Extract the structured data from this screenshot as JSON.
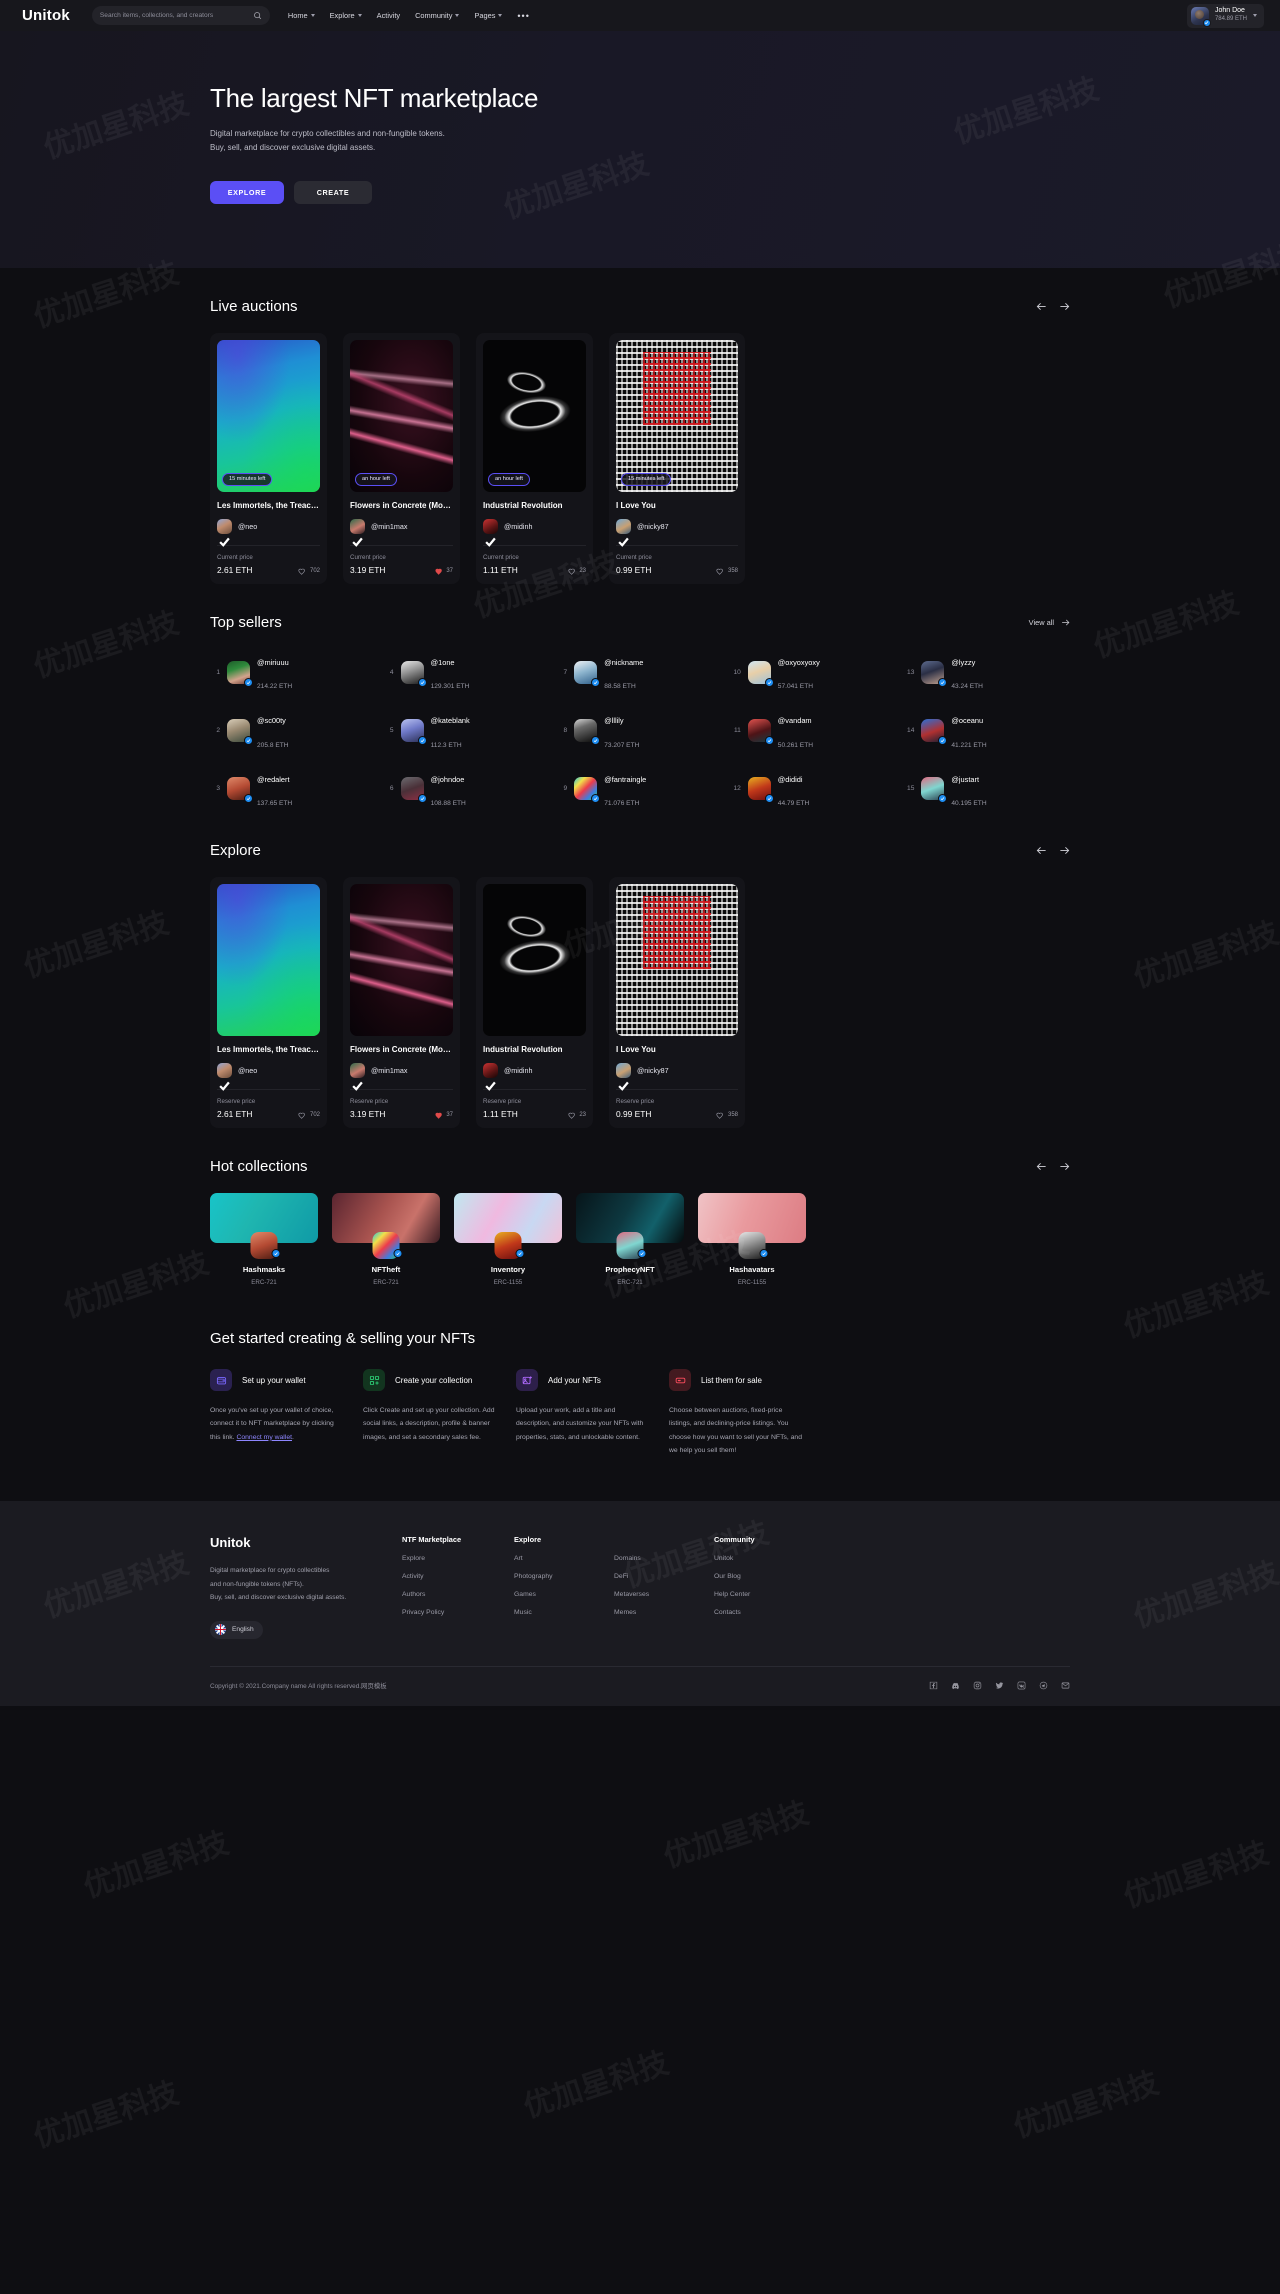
{
  "brand": {
    "name": "Unitok"
  },
  "header": {
    "search": {
      "placeholder": "Search items, collections, and creators",
      "value": "",
      "icon": "search-icon"
    },
    "nav": [
      {
        "label": "Home",
        "caret": true
      },
      {
        "label": "Explore",
        "caret": true
      },
      {
        "label": "Activity",
        "caret": false
      },
      {
        "label": "Community",
        "caret": true
      },
      {
        "label": "Pages",
        "caret": true
      }
    ],
    "more_label": "•••",
    "user": {
      "name": "John Doe",
      "balance": "784.89 ETH",
      "verified": true
    }
  },
  "hero": {
    "title": "The largest NFT marketplace",
    "subtitle_line1": "Digital marketplace for crypto collectibles and non-fungible tokens.",
    "subtitle_line2": "Buy, sell, and discover exclusive digital assets.",
    "primary_button": "EXPLORE",
    "secondary_button": "CREATE",
    "accent_color": "#5b4ff5"
  },
  "live_auctions": {
    "title": "Live auctions",
    "price_label": "Current price",
    "items": [
      {
        "title": "Les Immortels, the Treacher…",
        "badge": "15 minutes left",
        "creator": "@neo",
        "price": "2.61 ETH",
        "likes": "702",
        "liked": false,
        "art": "t-ocean",
        "avatar_class": "av-neo"
      },
      {
        "title": "Flowers in Concrete (Modal)",
        "badge": "an hour left",
        "creator": "@min1max",
        "price": "3.19 ETH",
        "likes": "37",
        "liked": true,
        "art": "t-flowers",
        "avatar_class": "av-min1max"
      },
      {
        "title": "Industrial Revolution",
        "badge": "an hour left",
        "creator": "@midinh",
        "price": "1.11 ETH",
        "likes": "23",
        "liked": false,
        "art": "t-indus",
        "avatar_class": "av-midinh"
      },
      {
        "title": "I Love You",
        "badge": "15 minutes left",
        "creator": "@nicky87",
        "price": "0.99 ETH",
        "likes": "358",
        "liked": false,
        "art": "t-binary",
        "avatar_class": "av-nicky"
      }
    ]
  },
  "top_sellers": {
    "title": "Top sellers",
    "view_all": "View all",
    "items": [
      {
        "rank": "1",
        "name": "@miriuuu",
        "eth": "214.22 ETH",
        "avatar_class": "av-miriuuu"
      },
      {
        "rank": "2",
        "name": "@sc00ty",
        "eth": "205.8 ETH",
        "avatar_class": "av-sc00ty"
      },
      {
        "rank": "3",
        "name": "@redalert",
        "eth": "137.65 ETH",
        "avatar_class": "av-redalert"
      },
      {
        "rank": "4",
        "name": "@1one",
        "eth": "129.301 ETH",
        "avatar_class": "av-1one"
      },
      {
        "rank": "5",
        "name": "@kateblank",
        "eth": "112.3 ETH",
        "avatar_class": "av-kateblank"
      },
      {
        "rank": "6",
        "name": "@johndoe",
        "eth": "108.88 ETH",
        "avatar_class": "av-johndoe"
      },
      {
        "rank": "7",
        "name": "@nickname",
        "eth": "88.58 ETH",
        "avatar_class": "av-nickname"
      },
      {
        "rank": "8",
        "name": "@lllily",
        "eth": "73.207 ETH",
        "avatar_class": "av-lllily"
      },
      {
        "rank": "9",
        "name": "@fantraingle",
        "eth": "71.076 ETH",
        "avatar_class": "av-fantraingle"
      },
      {
        "rank": "10",
        "name": "@oxyoxyoxy",
        "eth": "57.041 ETH",
        "avatar_class": "av-oxy"
      },
      {
        "rank": "11",
        "name": "@vandam",
        "eth": "50.261 ETH",
        "avatar_class": "av-vandam"
      },
      {
        "rank": "12",
        "name": "@dididi",
        "eth": "44.79 ETH",
        "avatar_class": "av-dididi"
      },
      {
        "rank": "13",
        "name": "@lyzzy",
        "eth": "43.24 ETH",
        "avatar_class": "av-lyzzy"
      },
      {
        "rank": "14",
        "name": "@oceanu",
        "eth": "41.221 ETH",
        "avatar_class": "av-oceanu"
      },
      {
        "rank": "15",
        "name": "@justart",
        "eth": "40.195 ETH",
        "avatar_class": "av-justart"
      }
    ]
  },
  "explore": {
    "title": "Explore",
    "price_label": "Reserve price",
    "items": [
      {
        "title": "Les Immortels, the Treacher…",
        "creator": "@neo",
        "price": "2.61 ETH",
        "likes": "702",
        "liked": false,
        "art": "t-ocean",
        "avatar_class": "av-neo"
      },
      {
        "title": "Flowers in Concrete (Modal)",
        "creator": "@min1max",
        "price": "3.19 ETH",
        "likes": "37",
        "liked": true,
        "art": "t-flowers",
        "avatar_class": "av-min1max"
      },
      {
        "title": "Industrial Revolution",
        "creator": "@midinh",
        "price": "1.11 ETH",
        "likes": "23",
        "liked": false,
        "art": "t-indus",
        "avatar_class": "av-midinh"
      },
      {
        "title": "I Love You",
        "creator": "@nicky87",
        "price": "0.99 ETH",
        "likes": "358",
        "liked": false,
        "art": "t-binary",
        "avatar_class": "av-nicky"
      }
    ]
  },
  "hot_collections": {
    "title": "Hot collections",
    "items": [
      {
        "name": "Hashmasks",
        "standard": "ERC-721",
        "banner_class": "bn-teal",
        "avatar_class": "av-redalert"
      },
      {
        "name": "NFTheft",
        "standard": "ERC-721",
        "banner_class": "bn-canyon",
        "avatar_class": "av-fantraingle"
      },
      {
        "name": "Inventory",
        "standard": "ERC-1155",
        "banner_class": "bn-pastel",
        "avatar_class": "av-dididi"
      },
      {
        "name": "ProphecyNFT",
        "standard": "ERC-721",
        "banner_class": "bn-nebula",
        "avatar_class": "av-justart"
      },
      {
        "name": "Hashavatars",
        "standard": "ERC-1155",
        "banner_class": "bn-pink",
        "avatar_class": "av-1one"
      }
    ]
  },
  "get_started": {
    "title": "Get started creating & selling your NFTs",
    "steps": [
      {
        "icon": "wallet-icon",
        "icon_color": "#7a68ff",
        "icon_bg": "#2a2150",
        "title": "Set up your wallet",
        "text": "Once you've set up your wallet of choice, connect it to NFT marketplace by clicking this link. ",
        "link": "Connect my wallet",
        "link_suffix": "."
      },
      {
        "icon": "collection-grid-icon",
        "icon_color": "#2ed47a",
        "icon_bg": "#12351f",
        "title": "Create your collection",
        "text": "Click Create and set up your collection. Add social links, a description, profile & banner images, and set a secondary sales fee.",
        "link": "",
        "link_suffix": ""
      },
      {
        "icon": "image-add-icon",
        "icon_color": "#b06bff",
        "icon_bg": "#2d1f4a",
        "title": "Add your NFTs",
        "text": "Upload your work, add a title and description, and customize your NFTs with properties, stats, and unlockable content.",
        "link": "",
        "link_suffix": ""
      },
      {
        "icon": "price-tag-icon",
        "icon_color": "#ff4d5e",
        "icon_bg": "#431a20",
        "title": "List them for sale",
        "text": "Choose between auctions, fixed-price listings, and declining-price listings. You choose how you want to sell your NFTs, and we help you sell them!",
        "link": "",
        "link_suffix": ""
      }
    ]
  },
  "footer": {
    "brand": "Unitok",
    "desc_line1": "Digital marketplace for crypto collectibles",
    "desc_line2": "and non-fungible tokens (NFTs).",
    "desc_line3": "Buy, sell, and discover exclusive digital assets.",
    "language": "English",
    "columns": [
      {
        "heading": "NTF Marketplace",
        "links": [
          "Explore",
          "Activity",
          "Authors",
          "Privacy Policy"
        ]
      },
      {
        "heading": "Explore",
        "links": [
          "Art",
          "Photography",
          "Games",
          "Music"
        ]
      },
      {
        "heading": "",
        "links": [
          "Domains",
          "DeFi",
          "Metaverses",
          "Memes"
        ]
      },
      {
        "heading": "Community",
        "links": [
          "Unitok",
          "Our Blog",
          "Help Center",
          "Contacts"
        ]
      }
    ],
    "copyright": "Copyright © 2021.Company name All rights reserved.网页模板",
    "socials": [
      "facebook-icon",
      "discord-icon",
      "instagram-icon",
      "twitter-icon",
      "vk-icon",
      "telegram-icon",
      "email-icon"
    ]
  },
  "watermark_text": "优加星科技"
}
